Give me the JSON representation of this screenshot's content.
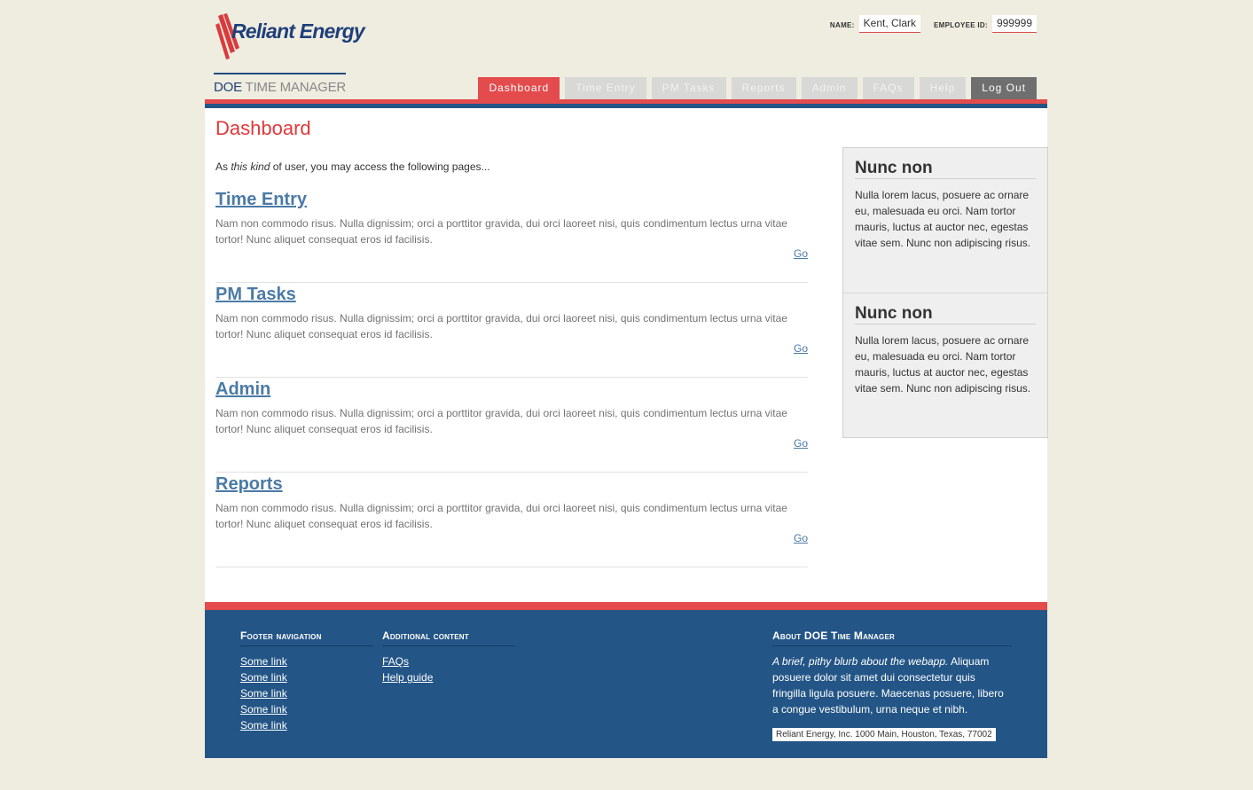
{
  "brand": {
    "logo_text": "Reliant Energy",
    "app_name_primary": "DOE",
    "app_name_secondary": "TIME MANAGER"
  },
  "user": {
    "name_label": "NAME:",
    "name_value": "Kent, Clark",
    "employee_id_label": "EMPLOYEE ID:",
    "employee_id_value": "999999"
  },
  "nav": {
    "tabs": [
      {
        "label": "Dashboard",
        "active": true
      },
      {
        "label": "Time Entry"
      },
      {
        "label": "PM Tasks"
      },
      {
        "label": "Reports"
      },
      {
        "label": "Admin"
      },
      {
        "label": "FAQs"
      },
      {
        "label": "Help"
      },
      {
        "label": "Log Out"
      }
    ]
  },
  "main": {
    "title": "Dashboard",
    "intro_prefix": "As ",
    "intro_em": "this kind",
    "intro_suffix": " of user, you may access the following pages...",
    "sections": [
      {
        "title": "Time Entry",
        "desc": "Nam non commodo risus. Nulla dignissim; orci a porttitor gravida, dui orci laoreet nisi, quis condimentum lectus urna vitae tortor! Nunc aliquet consequat eros id facilisis.",
        "go": "Go"
      },
      {
        "title": "PM Tasks",
        "desc": "Nam non commodo risus. Nulla dignissim; orci a porttitor gravida, dui orci laoreet nisi, quis condimentum lectus urna vitae tortor! Nunc aliquet consequat eros id facilisis.",
        "go": "Go"
      },
      {
        "title": "Admin",
        "desc": "Nam non commodo risus. Nulla dignissim; orci a porttitor gravida, dui orci laoreet nisi, quis condimentum lectus urna vitae tortor! Nunc aliquet consequat eros id facilisis.",
        "go": "Go"
      },
      {
        "title": "Reports",
        "desc": "Nam non commodo risus. Nulla dignissim; orci a porttitor gravida, dui orci laoreet nisi, quis condimentum lectus urna vitae tortor! Nunc aliquet consequat eros id facilisis.",
        "go": "Go"
      }
    ]
  },
  "sidebar": {
    "boxes": [
      {
        "title": "Nunc non",
        "text": "Nulla lorem lacus, posuere ac ornare eu, malesuada eu orci. Nam tortor mauris, luctus at auctor nec, egestas vitae sem. Nunc non adipiscing risus."
      },
      {
        "title": "Nunc non",
        "text": "Nulla lorem lacus, posuere ac ornare eu, malesuada eu orci. Nam tortor mauris, luctus at auctor nec, egestas vitae sem. Nunc non adipiscing risus."
      }
    ]
  },
  "footer": {
    "nav_heading": "Footer navigation",
    "nav_links": [
      "Some link",
      "Some link",
      "Some link",
      "Some link",
      "Some link"
    ],
    "additional_heading": "Additional content",
    "additional_links": [
      "FAQs",
      "Help guide"
    ],
    "about_heading": "About DOE Time Manager",
    "about_em": "A brief, pithy blurb about the webapp.",
    "about_text": " Aliquam posuere dolor sit amet dui consectetur quis fringilla ligula posuere. Maecenas posuere, libero a congue vestibulum, urna neque et nibh.",
    "address": "Reliant Energy, Inc. 1000 Main, Houston, Texas, 77002"
  },
  "colors": {
    "page_bg": "#efece0",
    "accent_red": "#e34b4d",
    "brand_blue": "#235586",
    "link_blue": "#4b7aa6",
    "tab_inactive": "#d8d8d6",
    "tab_logout": "#6f6f6f"
  }
}
